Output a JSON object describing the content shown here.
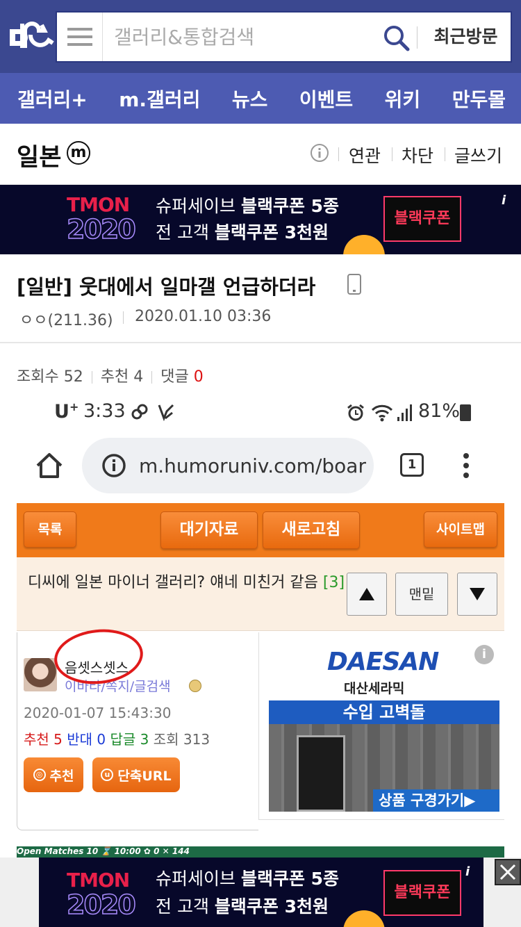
{
  "header": {
    "search_placeholder": "갤러리&통합검색",
    "recent_label": "최근방문"
  },
  "nav": {
    "items": [
      "갤러리+",
      "m.갤러리",
      "뉴스",
      "이벤트",
      "위키",
      "만두몰"
    ]
  },
  "gallery": {
    "title": "일본",
    "badge": "m",
    "actions": [
      "연관",
      "차단",
      "글쓰기"
    ]
  },
  "ad_tmon": {
    "logo_line1": "TMON",
    "logo_line2": "2020",
    "copy_line1_a": "슈퍼세이브 ",
    "copy_line1_b": "블랙쿠폰 5종",
    "copy_line2_a": "전 고객 ",
    "copy_line2_b": "블랙쿠폰 3천원",
    "button": "블랙쿠폰",
    "info": "i"
  },
  "post": {
    "title": "[일반] 웃대에서 일마갤 언급하더라",
    "author": "ㅇㅇ(211.36)",
    "date": "2020.01.10 03:36",
    "views_label": "조회수 52",
    "recommend_label": "추천 4",
    "comments_label": "댓글 ",
    "comments_count": "0"
  },
  "embedded": {
    "status_carrier": "U",
    "status_carrier_sup": "+",
    "status_time": "3:33",
    "status_battery": "81%",
    "url": "m.humoruniv.com/boar",
    "tabs_count": "1",
    "toolbar": {
      "list_btn": "목록",
      "pending_btn": "대기자료",
      "refresh_btn": "새로고침",
      "sitemap_btn": "사이트맵"
    },
    "thread_title": "디씨에 일본 마이너 갤러리? 얘네 미친거 같음 ",
    "thread_comment_count": "[3]",
    "bottom_btn": "맨밑",
    "user": {
      "nickname": "음셋스셋스",
      "links": "이바타/쪽지/글검색",
      "time": "2020-01-07 15:43:30",
      "rec_label": "추천 ",
      "rec_val": "5",
      "opp_label": " 반대 ",
      "opp_val": "0",
      "reply_label": " 답글 ",
      "reply_val": "3",
      "view_label": " 조회 313",
      "recommend_btn": "추천",
      "shorturl_btn": "단축URL"
    },
    "ad_daesan": {
      "logo": "DAESAN",
      "sub": "대산세라믹",
      "band": "수입 고벽돌",
      "cta": "상품 구경가기▶",
      "info": "i"
    },
    "strip_text": "Open Matches  10     ⌛ 10:00          ✿  0              ✕ 144"
  }
}
